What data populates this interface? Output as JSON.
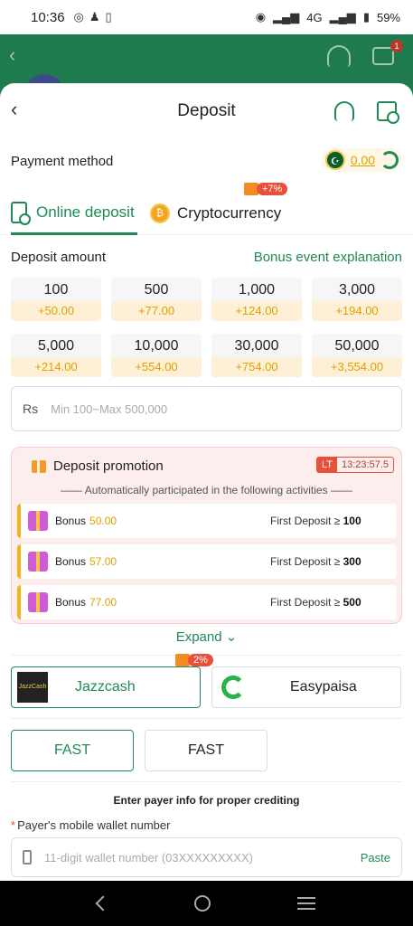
{
  "status_bar": {
    "time": "10:36",
    "network": "4G",
    "battery": "59%"
  },
  "background_header": {
    "notification_count": "1"
  },
  "header": {
    "title": "Deposit"
  },
  "payment_method": {
    "label": "Payment method",
    "balance": "0.00"
  },
  "tabs": [
    {
      "label": "Online deposit",
      "active": true
    },
    {
      "label": "Cryptocurrency",
      "active": false,
      "badge": "+7%"
    }
  ],
  "deposit_amount": {
    "label": "Deposit amount",
    "bonus_link": "Bonus event explanation",
    "options": [
      {
        "value": "100",
        "bonus": "+50.00"
      },
      {
        "value": "500",
        "bonus": "+77.00"
      },
      {
        "value": "1,000",
        "bonus": "+124.00"
      },
      {
        "value": "3,000",
        "bonus": "+194.00"
      },
      {
        "value": "5,000",
        "bonus": "+214.00"
      },
      {
        "value": "10,000",
        "bonus": "+554.00"
      },
      {
        "value": "30,000",
        "bonus": "+754.00"
      },
      {
        "value": "50,000",
        "bonus": "+3,554.00"
      }
    ],
    "currency": "Rs",
    "placeholder": "Min 100~Max 500,000"
  },
  "promotion": {
    "title": "Deposit promotion",
    "badge": "LT",
    "timer": "13:23:57.5",
    "subtitle": "—— Automatically participated in the following activities ——",
    "rows": [
      {
        "bonus_label": "Bonus",
        "bonus_value": "50.00",
        "condition": "First Deposit ≥",
        "threshold": "100"
      },
      {
        "bonus_label": "Bonus",
        "bonus_value": "57.00",
        "condition": "First Deposit ≥",
        "threshold": "300"
      },
      {
        "bonus_label": "Bonus",
        "bonus_value": "77.00",
        "condition": "First Deposit ≥",
        "threshold": "500"
      }
    ],
    "expand_label": "Expand"
  },
  "channels": [
    {
      "name": "Jazzcash",
      "logo_text": "JazzCash",
      "badge": "2%",
      "active": true
    },
    {
      "name": "Easypaisa",
      "active": false
    }
  ],
  "speed_options": [
    {
      "label": "FAST",
      "active": true
    },
    {
      "label": "FAST",
      "active": false
    }
  ],
  "payer": {
    "note": "Enter payer info for proper crediting",
    "required_mark": "*",
    "wallet_label": "Payer's mobile wallet number",
    "wallet_placeholder": "11-digit wallet number (03XXXXXXXXX)",
    "paste_label": "Paste"
  },
  "colors": {
    "brand_green": "#1f8a56",
    "bonus_gold": "#e0a100",
    "alert_red": "#e8503a"
  }
}
